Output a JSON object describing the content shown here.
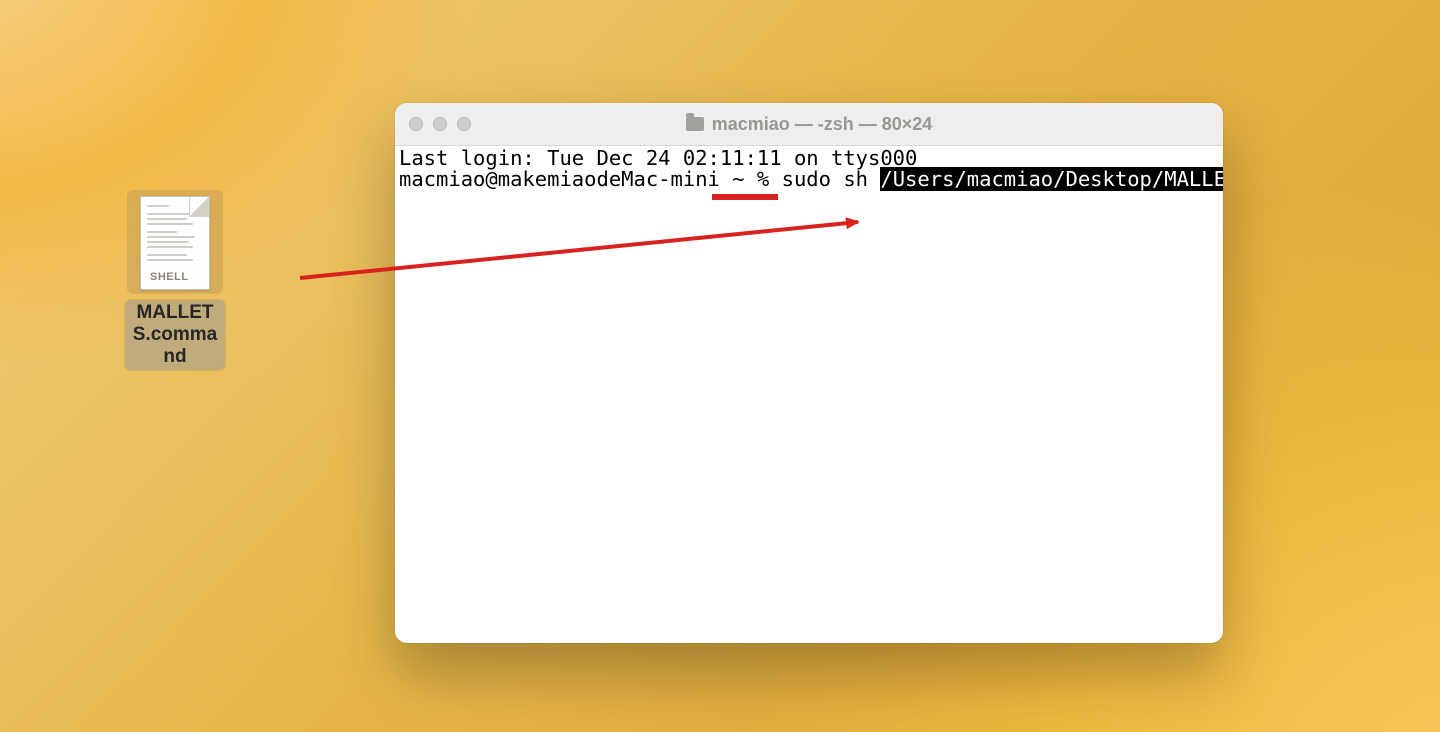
{
  "desktop": {
    "file": {
      "label": "MALLETS.command",
      "shell_tag": "SHELL"
    }
  },
  "terminal": {
    "title": "macmiao — -zsh — 80×24",
    "last_login": "Last login: Tue Dec 24 02:11:11 on ttys000",
    "prompt": "macmiao@makemiaodeMac-mini ~ % ",
    "plain_input": "sudo sh ",
    "highlighted_input": "/Users/macmiao/Desktop/MALLETS.command "
  },
  "annotation": {
    "arrow_color": "#d8221e",
    "underline_color": "#d8221e"
  }
}
